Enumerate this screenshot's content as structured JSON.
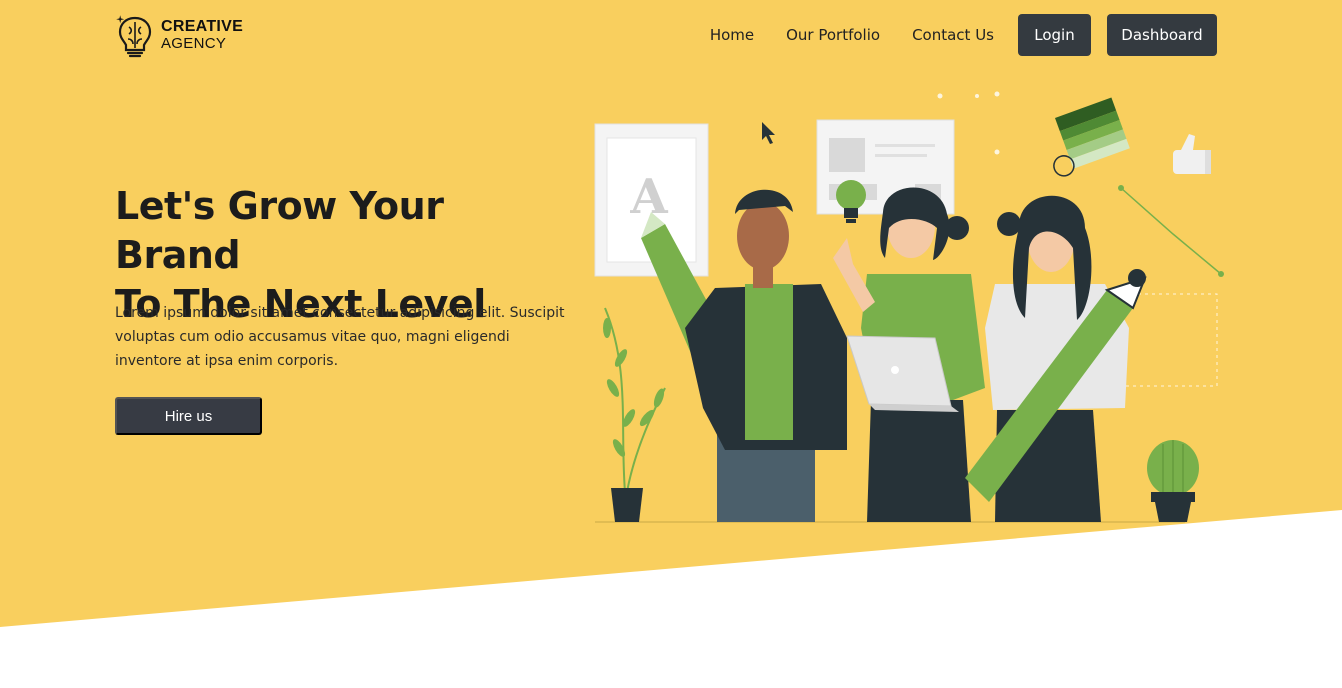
{
  "brand": {
    "line1": "CREATIVE",
    "line2": "AGENCY"
  },
  "nav": {
    "links": [
      "Home",
      "Our Portfolio",
      "Contact Us"
    ],
    "login_label": "Login",
    "dashboard_label": "Dashboard"
  },
  "hero": {
    "title_line1": "Let's Grow Your Brand",
    "title_line2": "To The Next Level",
    "description": "Lorem ipsum dolor sit amet consectetur adipisicing elit. Suscipit voluptas cum odio accusamus vitae quo, magni eligendi inventore at ipsa enim corporis.",
    "cta_label": "Hire us",
    "illustration_letter": "A"
  },
  "colors": {
    "hero_background": "#f9cf5e",
    "button_dark": "#343a40",
    "illustration_green": "#79b04b",
    "illustration_dark": "#263238"
  },
  "icons": [
    "lightbulb-logo-icon",
    "cursor-icon",
    "thumbs-up-icon",
    "color-swatch-icon",
    "lightbulb-icon",
    "pen-tool-icon",
    "laptop-icon"
  ]
}
